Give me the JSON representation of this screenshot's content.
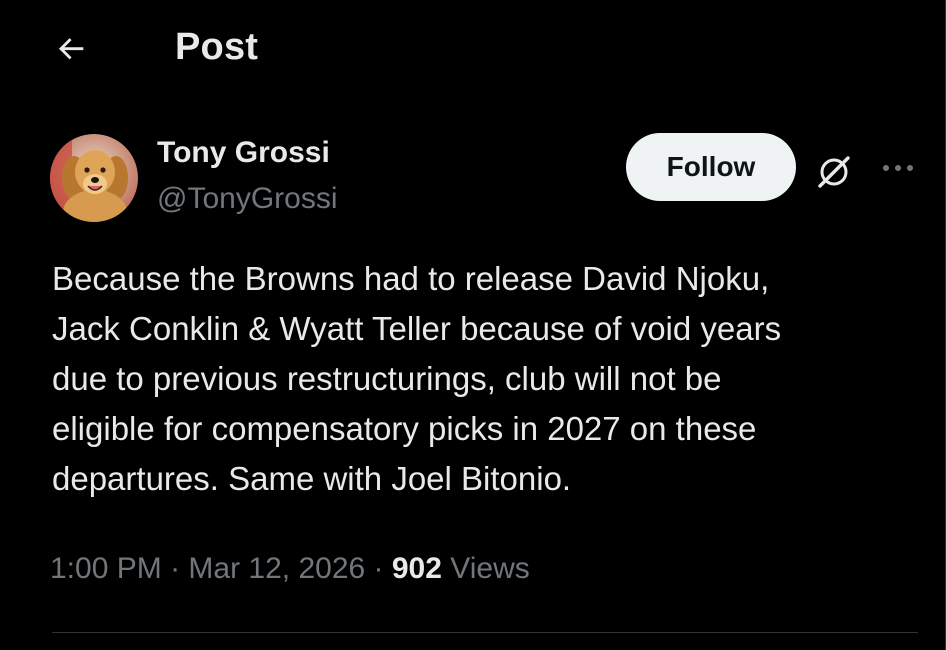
{
  "header": {
    "title": "Post",
    "back_icon": "arrow-left-icon"
  },
  "author": {
    "name": "Tony Grossi",
    "handle": "@TonyGrossi",
    "avatar_icon": "golden-retriever-avatar"
  },
  "actions": {
    "follow_label": "Follow",
    "grok_icon": "grok-icon",
    "more_icon": "more-dots-icon"
  },
  "tweet": {
    "text": "Because the Browns had to release David Njoku,\nJack Conklin & Wyatt Teller because of void years\ndue to previous restructurings, club will not be\neligible for compensatory picks in 2027 on these\ndepartures. Same with Joel Bitonio."
  },
  "meta": {
    "time": "1:00 PM",
    "separator": " · ",
    "date": "Mar 12, 2026",
    "views_count": "902",
    "views_label": "Views"
  },
  "colors": {
    "background": "#000000",
    "text_primary": "#e7e9ea",
    "text_secondary": "#71767b",
    "follow_bg": "#eff3f4",
    "follow_text": "#0f1419",
    "divider": "#2f3336"
  }
}
